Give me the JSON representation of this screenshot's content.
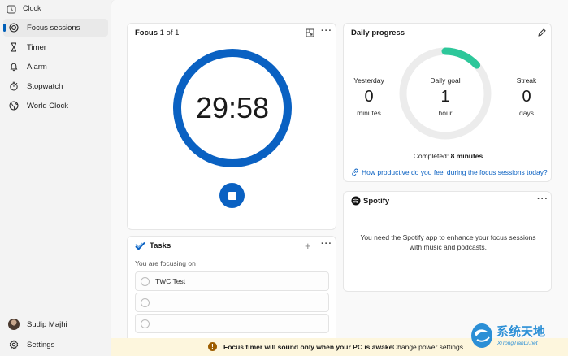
{
  "app": {
    "title": "Clock",
    "window_controls": {
      "minimize": "—",
      "maximize": "☐",
      "close": "✕"
    }
  },
  "sidebar": {
    "items": [
      {
        "label": "Focus sessions",
        "icon": "focus-icon",
        "active": true
      },
      {
        "label": "Timer",
        "icon": "hourglass-icon"
      },
      {
        "label": "Alarm",
        "icon": "bell-icon"
      },
      {
        "label": "Stopwatch",
        "icon": "stopwatch-icon"
      },
      {
        "label": "World Clock",
        "icon": "globe-icon"
      }
    ],
    "user": {
      "name": "Sudip Majhi"
    },
    "settings_label": "Settings"
  },
  "focus": {
    "title": "Focus",
    "subtitle": "1 of 1",
    "timer": "29:58",
    "more": "···"
  },
  "daily_progress": {
    "title": "Daily progress",
    "yesterday": {
      "label": "Yesterday",
      "value": "0",
      "unit": "minutes"
    },
    "goal": {
      "label": "Daily goal",
      "value": "1",
      "unit": "hour"
    },
    "streak": {
      "label": "Streak",
      "value": "0",
      "unit": "days"
    },
    "completed_prefix": "Completed:",
    "completed_value": "8 minutes",
    "progress_fraction": 0.133,
    "link": "How productive do you feel during the focus sessions today?"
  },
  "spotify": {
    "name": "Spotify",
    "message": "You need the Spotify app to enhance your focus sessions with music and podcasts.",
    "more": "···"
  },
  "tasks": {
    "title": "Tasks",
    "add": "+",
    "more": "···",
    "focusing_label": "You are focusing on",
    "items": [
      "TWC Test",
      "",
      ""
    ]
  },
  "banner": {
    "icon": "!",
    "text": "Focus timer will sound only when your PC is awake.",
    "link": "Change power settings"
  },
  "watermark": {
    "title": "系统天地",
    "url": "XiTongTianDi.net"
  },
  "colors": {
    "accent": "#0a61c2",
    "progress": "#2dc79a",
    "banner_bg": "#fdf6dd"
  }
}
